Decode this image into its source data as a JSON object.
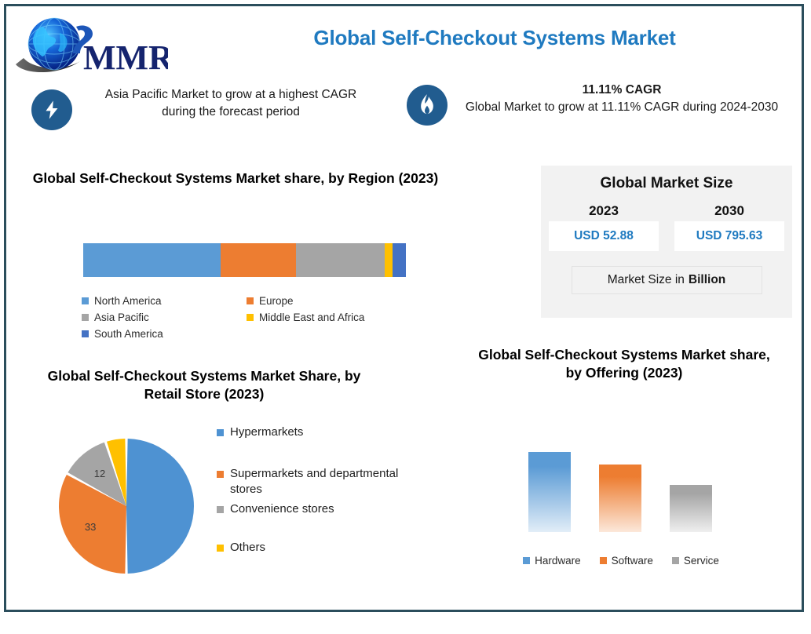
{
  "page": {
    "border_color": "#2b4e5c",
    "background": "#ffffff"
  },
  "header": {
    "logo": {
      "name": "mmr-logo",
      "text": "MMR",
      "globe_color": "#0b2fb0",
      "text_color": "#15246e"
    },
    "title": "Global Self-Checkout Systems Market",
    "title_color": "#1f7ac0"
  },
  "highlights": [
    {
      "icon": "lightning-bolt-icon",
      "icon_bg": "#215c8f",
      "heading": "",
      "text": "Asia Pacific Market to grow at a highest CAGR during the forecast period"
    },
    {
      "icon": "flame-icon",
      "icon_bg": "#215c8f",
      "heading": "11.11% CAGR",
      "text": "Global Market to grow at 11.11% CAGR during 2024-2030"
    }
  ],
  "market_size_card": {
    "title": "Global Market Size",
    "columns": [
      {
        "year": "2023",
        "value": "USD 52.88"
      },
      {
        "year": "2030",
        "value": "USD 795.63"
      }
    ],
    "unit_prefix": "Market Size in",
    "unit_bold": "Billion",
    "value_color": "#1f7ac0",
    "card_bg": "#f2f2f2"
  },
  "chart_data": [
    {
      "id": "region",
      "type": "bar",
      "orientation": "stacked-horizontal",
      "title": "Global Self-Checkout Systems Market share, by Region (2023)",
      "categories": [
        "North America",
        "Europe",
        "Asia Pacific",
        "Middle East and Africa",
        "South America"
      ],
      "values": [
        42.6,
        23.4,
        27.5,
        2.4,
        4.1
      ],
      "colors": [
        "#5b9bd5",
        "#ed7d31",
        "#a5a5a5",
        "#ffc000",
        "#4472c4"
      ],
      "legend_position": "bottom",
      "grid": false,
      "xlabel": "",
      "ylabel": ""
    },
    {
      "id": "retail_store",
      "type": "pie",
      "title": "Global Self-Checkout Systems Market Share, by Retail Store (2023)",
      "categories": [
        "Hypermarkets",
        "Supermarkets and departmental stores",
        "Convenience stores",
        "Others"
      ],
      "values": [
        50,
        33,
        12,
        5
      ],
      "data_labels": [
        "",
        "33",
        "12",
        ""
      ],
      "colors": [
        "#4e92d2",
        "#ed7d31",
        "#a5a5a5",
        "#ffc000"
      ],
      "legend_position": "right",
      "start_angle": 0
    },
    {
      "id": "offering",
      "type": "bar",
      "orientation": "vertical",
      "title": "Global Self-Checkout Systems Market share, by Offering (2023)",
      "categories": [
        "Hardware",
        "Software",
        "Service"
      ],
      "values": [
        93,
        78,
        55
      ],
      "ylim": [
        0,
        100
      ],
      "colors": [
        "#5b9bd5",
        "#ed7d31",
        "#a5a5a5"
      ],
      "legend_position": "bottom",
      "grid": false,
      "xlabel": "",
      "ylabel": ""
    }
  ]
}
